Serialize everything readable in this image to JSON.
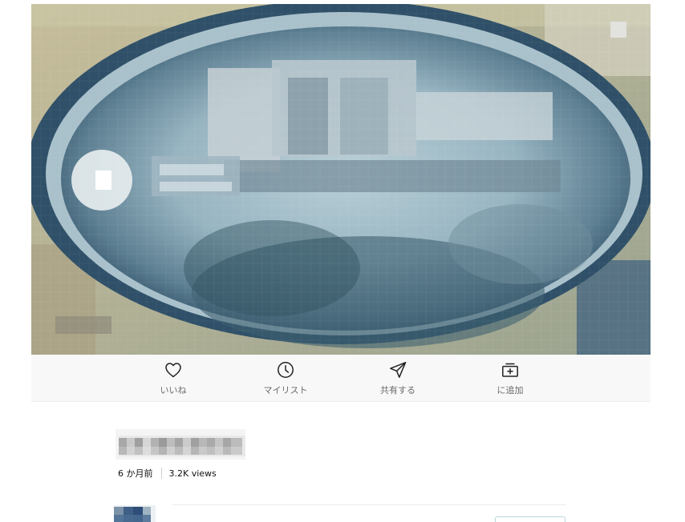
{
  "actions": [
    {
      "label": "いいね",
      "icon": "heart-icon"
    },
    {
      "label": "マイリスト",
      "icon": "clock-icon"
    },
    {
      "label": "共有する",
      "icon": "send-icon"
    },
    {
      "label": "に追加",
      "icon": "collection-add-icon"
    }
  ],
  "video": {
    "meta": {
      "age": "6 か月前",
      "views": "3.2K views"
    }
  },
  "colors": {
    "action_bar_background": "#f8f8f8",
    "label_text": "#6a6a6a",
    "icon_stroke": "#222222"
  }
}
